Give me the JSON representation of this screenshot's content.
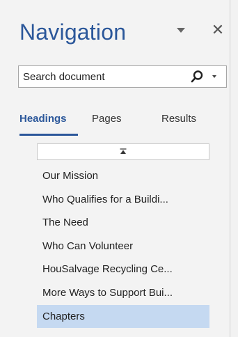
{
  "pane": {
    "title": "Navigation",
    "icons": {
      "options": "chevron-down-icon",
      "close": "close-icon",
      "search": "search-icon"
    }
  },
  "search": {
    "placeholder": "Search document"
  },
  "tabs": [
    {
      "label": "Headings",
      "active": true
    },
    {
      "label": "Pages",
      "active": false
    },
    {
      "label": "Results",
      "active": false
    }
  ],
  "headings": {
    "items": [
      {
        "label": "Our Mission"
      },
      {
        "label": "Who Qualifies for a Buildi..."
      },
      {
        "label": "The Need"
      },
      {
        "label": "Who Can Volunteer"
      },
      {
        "label": "HouSalvage Recycling Ce..."
      },
      {
        "label": "More Ways to Support Bui..."
      },
      {
        "label": "Chapters",
        "selected": true
      }
    ]
  },
  "colors": {
    "accent": "#2b579a",
    "selection": "#c5d9f1",
    "pane_background": "#f3f3f3"
  }
}
